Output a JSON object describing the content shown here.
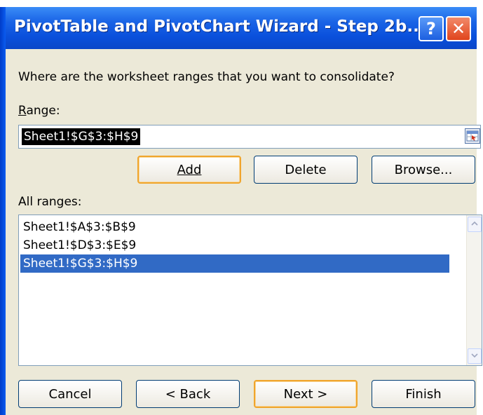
{
  "window": {
    "title": "PivotTable and PivotChart Wizard - Step 2b...",
    "help_label": "?",
    "close_label": "✕"
  },
  "prompt": "Where are the worksheet ranges that you want to consolidate?",
  "range": {
    "label": "Range:",
    "value": "Sheet1!$G$3:$H$9"
  },
  "range_buttons": {
    "add": "Add",
    "delete": "Delete",
    "browse": "Browse..."
  },
  "all_ranges": {
    "label": "All ranges:",
    "items": [
      "Sheet1!$A$3:$B$9",
      "Sheet1!$D$3:$E$9",
      "Sheet1!$G$3:$H$9"
    ],
    "selected_index": 2
  },
  "footer_buttons": {
    "cancel": "Cancel",
    "back": "< Back",
    "next": "Next >",
    "finish": "Finish"
  },
  "icons": {
    "help": "help-icon",
    "close": "close-icon",
    "range_picker": "collapse-dialog-icon",
    "scroll_up": "scroll-up-arrow-icon",
    "scroll_down": "scroll-down-arrow-icon"
  },
  "colors": {
    "titlebar": "#0a50dc",
    "selection": "#316ac5",
    "dialog_bg": "#ece9d8",
    "default_button_border": "#f0a52c"
  }
}
